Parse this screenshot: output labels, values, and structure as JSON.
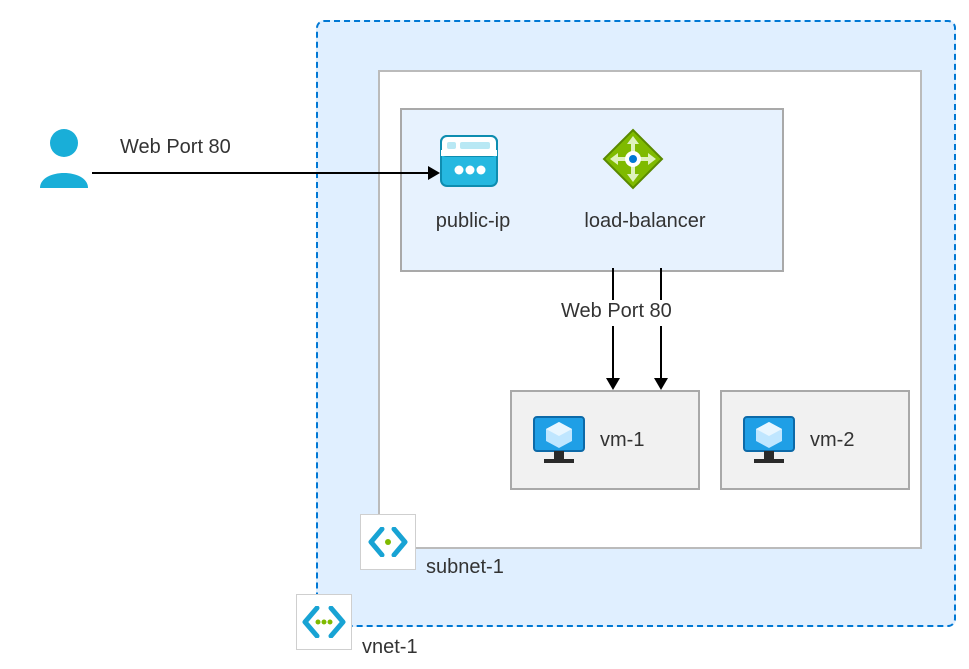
{
  "connection_in": {
    "label": "Web Port 80"
  },
  "connection_mid": {
    "label": "Web Port 80"
  },
  "vnet": {
    "label": "vnet-1"
  },
  "subnet": {
    "label": "subnet-1"
  },
  "frontend": {
    "public_ip": {
      "label": "public-ip"
    },
    "lb": {
      "label": "load-balancer"
    }
  },
  "vms": {
    "vm1": {
      "label": "vm-1"
    },
    "vm2": {
      "label": "vm-2"
    }
  }
}
